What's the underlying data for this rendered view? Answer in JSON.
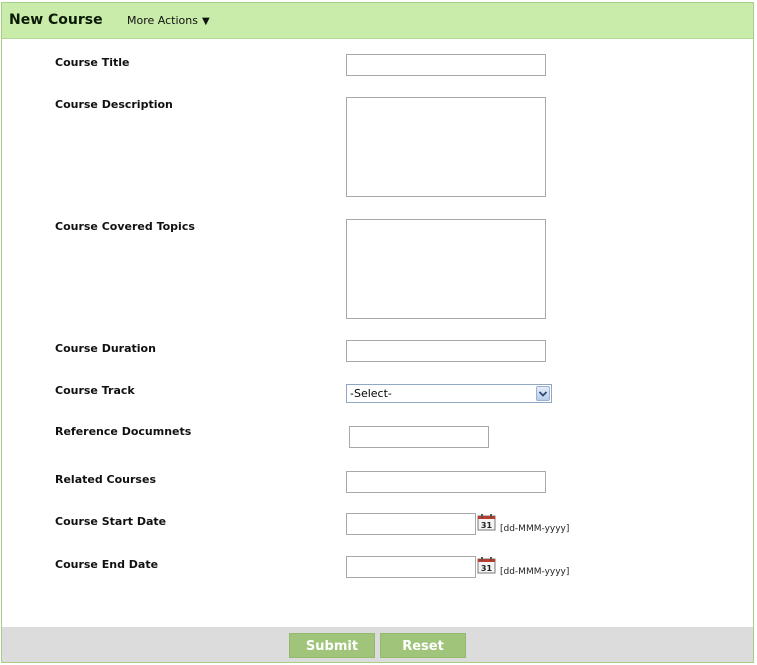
{
  "header": {
    "title": "New Course",
    "more_actions": "More Actions",
    "more_arrow": "▼"
  },
  "form": {
    "course_title": {
      "label": "Course Title",
      "value": ""
    },
    "course_description": {
      "label": "Course Description",
      "value": ""
    },
    "course_topics": {
      "label": "Course Covered Topics",
      "value": ""
    },
    "course_duration": {
      "label": "Course Duration",
      "value": ""
    },
    "course_track": {
      "label": "Course Track",
      "selected": "-Select-"
    },
    "reference_documents": {
      "label": "Reference Documnets",
      "value": ""
    },
    "related_courses": {
      "label": "Related Courses",
      "value": ""
    },
    "start_date": {
      "label": "Course Start Date",
      "value": "",
      "format": "[dd-MMM-yyyy]"
    },
    "end_date": {
      "label": "Course End Date",
      "value": "",
      "format": "[dd-MMM-yyyy]"
    }
  },
  "calendar_icon_text": "31",
  "footer": {
    "submit_label": "Submit",
    "reset_label": "Reset"
  },
  "colors": {
    "header_bg": "#c9ecaa",
    "button_bg": "#9fc47a",
    "footer_bg": "#dcdcdc",
    "border": "#a9cf86"
  }
}
